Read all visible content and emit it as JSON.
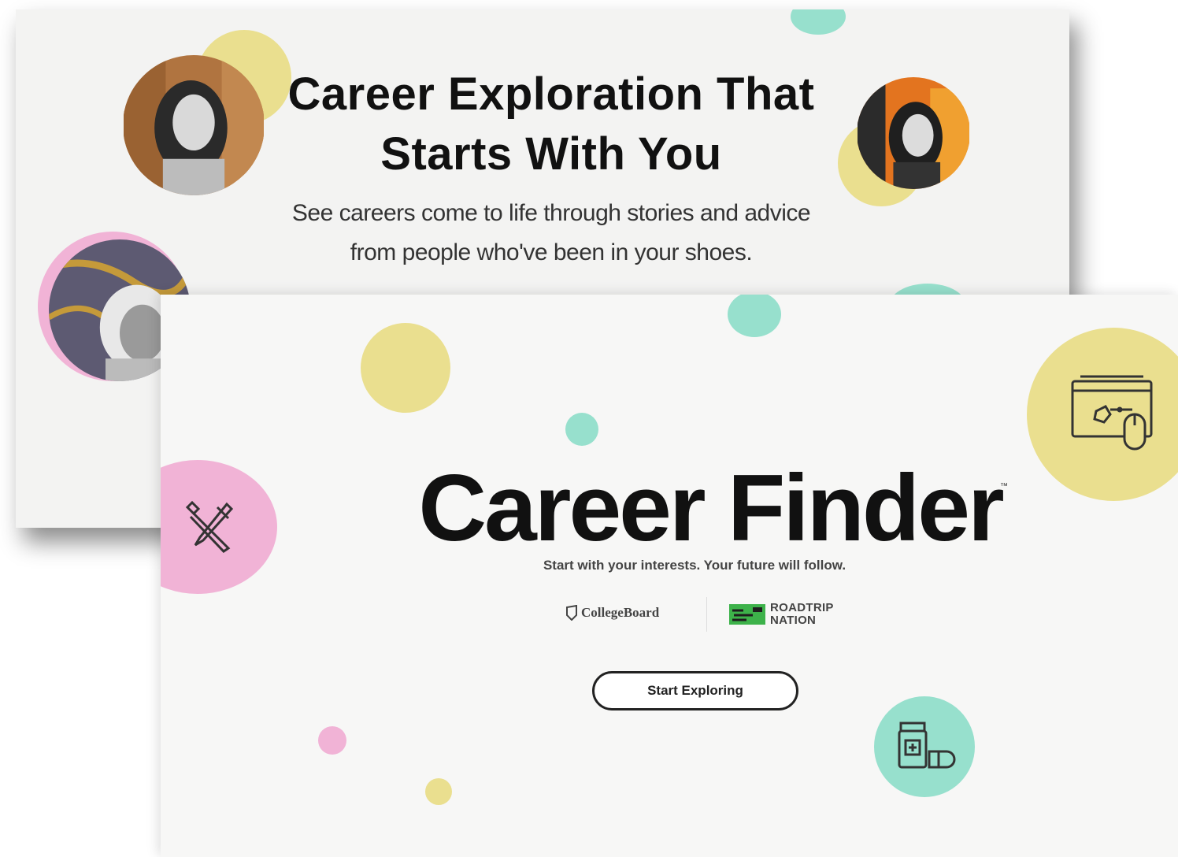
{
  "hero": {
    "headline_line1": "Career Exploration That",
    "headline_line2": "Starts With You",
    "subhead_line1": "See careers come to life through stories and advice",
    "subhead_line2": "from people who've been in your shoes."
  },
  "finder": {
    "title": "Career Finder",
    "trademark": "™",
    "tagline": "Start with your interests. Your future will follow.",
    "partner1": "CollegeBoard",
    "partner2_line1": "ROADTRIP",
    "partner2_line2": "NATION",
    "cta_label": "Start Exploring"
  },
  "colors": {
    "yellow": "#eadf8f",
    "teal": "#97e0cd",
    "pink": "#f1b3d6",
    "text": "#111111"
  },
  "icons": [
    "tools-icon",
    "computer-mouse-icon",
    "medicine-bottle-icon",
    "collegeboard-logo-icon",
    "roadtrip-nation-logo-icon"
  ]
}
